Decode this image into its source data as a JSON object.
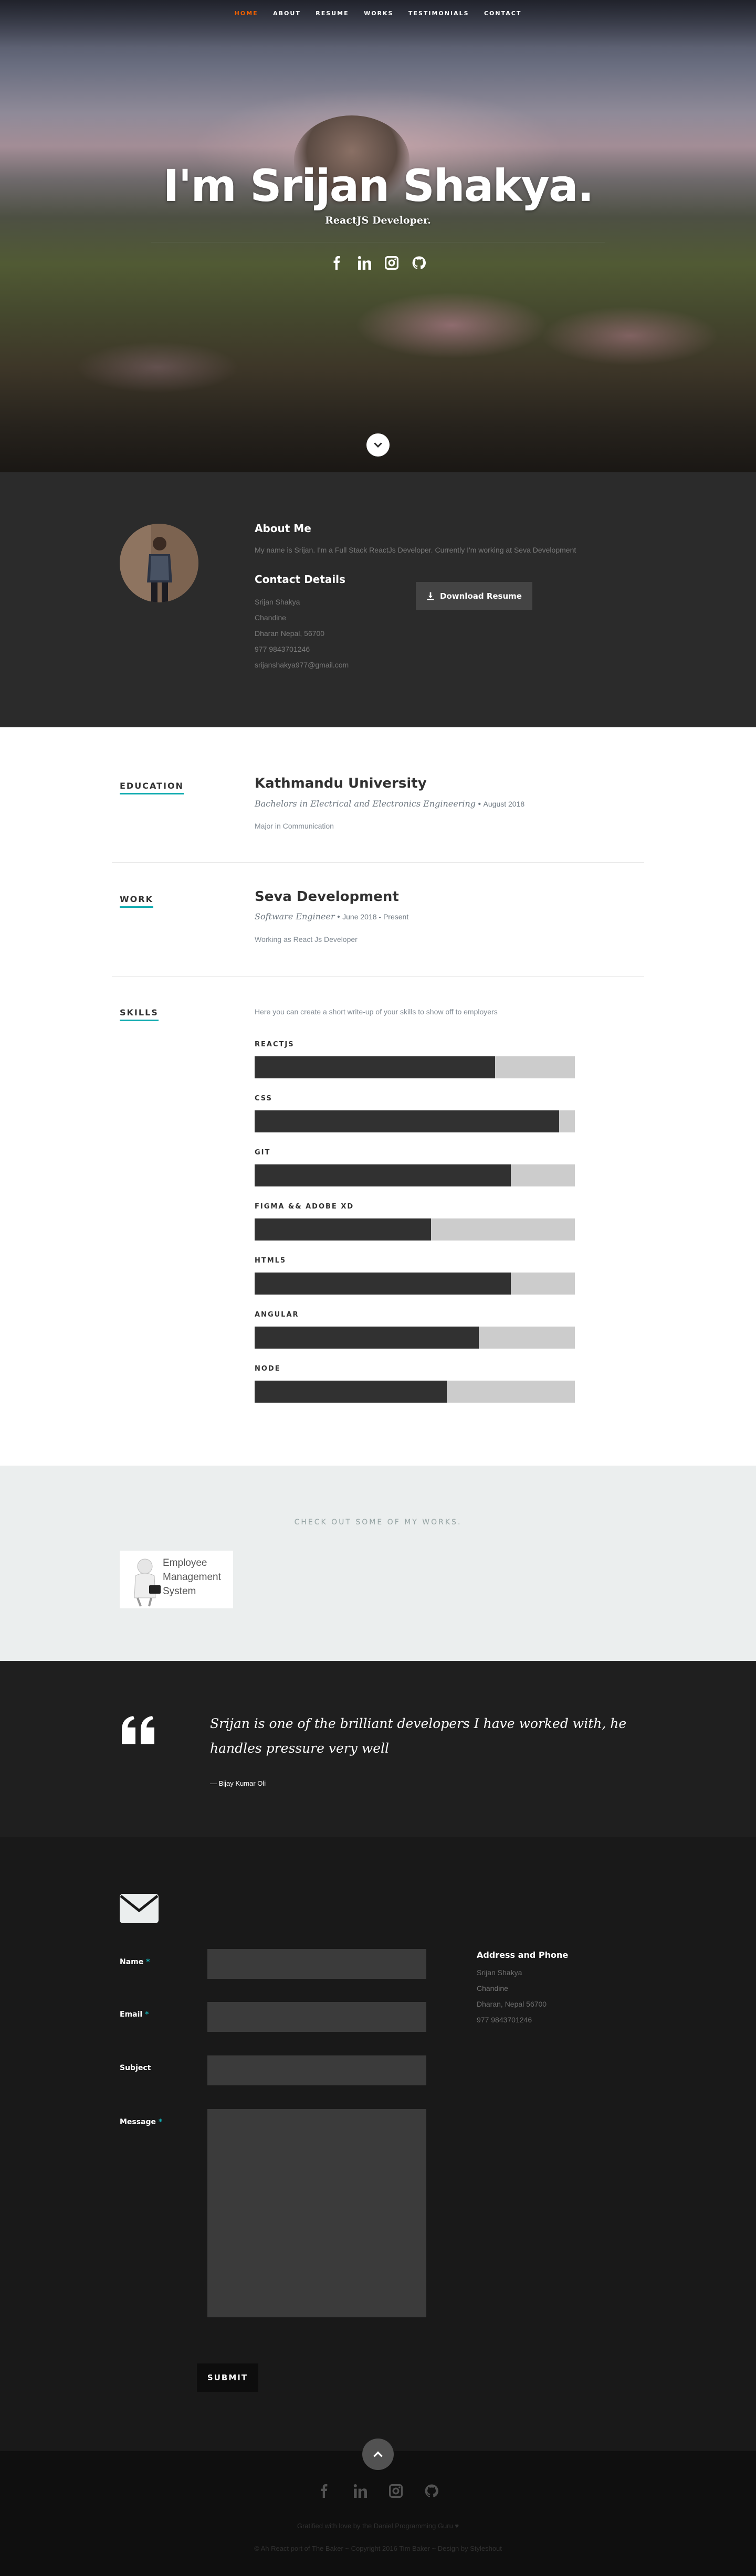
{
  "nav": {
    "items": [
      "Home",
      "About",
      "Resume",
      "Works",
      "Testimonials",
      "Contact"
    ],
    "current_index": 0,
    "accent_color": "#F06000"
  },
  "banner": {
    "headline": "I'm Srijan Shakya.",
    "subtitle": "ReactJS Developer.",
    "social_icons": [
      "facebook-icon",
      "linkedin-icon",
      "instagram-icon",
      "github-icon"
    ]
  },
  "about": {
    "title": "About Me",
    "bio": "My name is Srijan. I'm a Full Stack ReactJs Developer. Currently I'm working at Seva Development",
    "contact_title": "Contact Details",
    "contact_lines": [
      "Srijan Shakya",
      "Chandine",
      "Dharan Nepal, 56700",
      "977 9843701246",
      "srijanshakya977@gmail.com"
    ],
    "download_label": "Download Resume"
  },
  "resume": {
    "education": {
      "section_title": "Education",
      "school": "Kathmandu University",
      "degree": "Bachelors in Electrical and Electronics Engineering",
      "date": "August 2018",
      "description": "Major in Communication"
    },
    "work": {
      "section_title": "Work",
      "company": "Seva Development",
      "title": "Software Engineer",
      "years": "June 2018 - Present",
      "description": "Working as React Js Developer"
    },
    "skills": {
      "section_title": "Skills",
      "intro": "Here you can create a short write-up of your skills to show off to employers",
      "items": [
        {
          "name": "REACTJS",
          "level": 0.75
        },
        {
          "name": "CSS",
          "level": 0.95
        },
        {
          "name": "GIT",
          "level": 0.8
        },
        {
          "name": "FIGMA && ADOBE XD",
          "level": 0.55
        },
        {
          "name": "HTML5",
          "level": 0.8
        },
        {
          "name": "ANGULAR",
          "level": 0.7
        },
        {
          "name": "NODE",
          "level": 0.6
        }
      ],
      "bar_color": "#313131",
      "track_color": "#cccccc"
    }
  },
  "works": {
    "heading": "Check Out Some of My Works.",
    "items": [
      {
        "title_lines": [
          "Employee",
          "Management",
          "System"
        ]
      }
    ]
  },
  "testimonials": {
    "quote": "Srijan is one of the brilliant developers I have worked with, he handles pressure very well",
    "author": "— Bijay Kumar Oli"
  },
  "contact": {
    "fields": [
      {
        "label": "Name",
        "required": true
      },
      {
        "label": "Email",
        "required": true
      },
      {
        "label": "Subject",
        "required": false
      },
      {
        "label": "Message",
        "required": true
      }
    ],
    "submit_label": "Submit",
    "address_title": "Address and Phone",
    "address_lines": [
      "Srijan Shakya",
      "Chandine",
      "Dharan, Nepal 56700",
      "977 9843701246"
    ],
    "accent_color": "#11ABB0"
  },
  "footer": {
    "social_icons": [
      "facebook-icon",
      "linkedin-icon",
      "instagram-icon",
      "github-icon"
    ],
    "credit": "Gratified with love by the Daniel Programming Guru ♥",
    "copyright": "© Ah React port of The Baker ~ Copyright 2016 Tim Baker ~ Design by Styleshout"
  }
}
